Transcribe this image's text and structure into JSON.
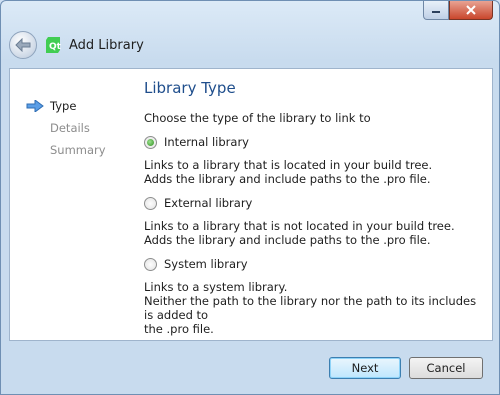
{
  "window": {
    "controls": [
      "minimize-icon",
      "close-icon"
    ]
  },
  "header": {
    "title": "Add Library",
    "back_icon": "back-arrow-icon",
    "app_icon": "qt-creator-icon"
  },
  "nav": {
    "items": [
      {
        "label": "Type",
        "state": "active"
      },
      {
        "label": "Details",
        "state": "inactive"
      },
      {
        "label": "Summary",
        "state": "inactive"
      }
    ]
  },
  "main": {
    "title": "Library Type",
    "subtitle": "Choose the type of the library to link to",
    "options": [
      {
        "label": "Internal library",
        "checked": true,
        "desc_lines": [
          "Links to a library that is located in your build tree.",
          "Adds the library and include paths to the .pro file."
        ]
      },
      {
        "label": "External library",
        "checked": false,
        "desc_lines": [
          "Links to a library that is not located in your build tree.",
          "Adds the library and include paths to the .pro file."
        ]
      },
      {
        "label": "System library",
        "checked": false,
        "desc_lines": [
          "Links to a system library.",
          "Neither the path to the library nor the path to its includes is added to",
          "the .pro file."
        ]
      }
    ]
  },
  "footer": {
    "next_label": "Next",
    "cancel_label": "Cancel"
  },
  "colors": {
    "title_blue": "#1f4e8c",
    "accent_arrow": "#3b7fd0"
  }
}
